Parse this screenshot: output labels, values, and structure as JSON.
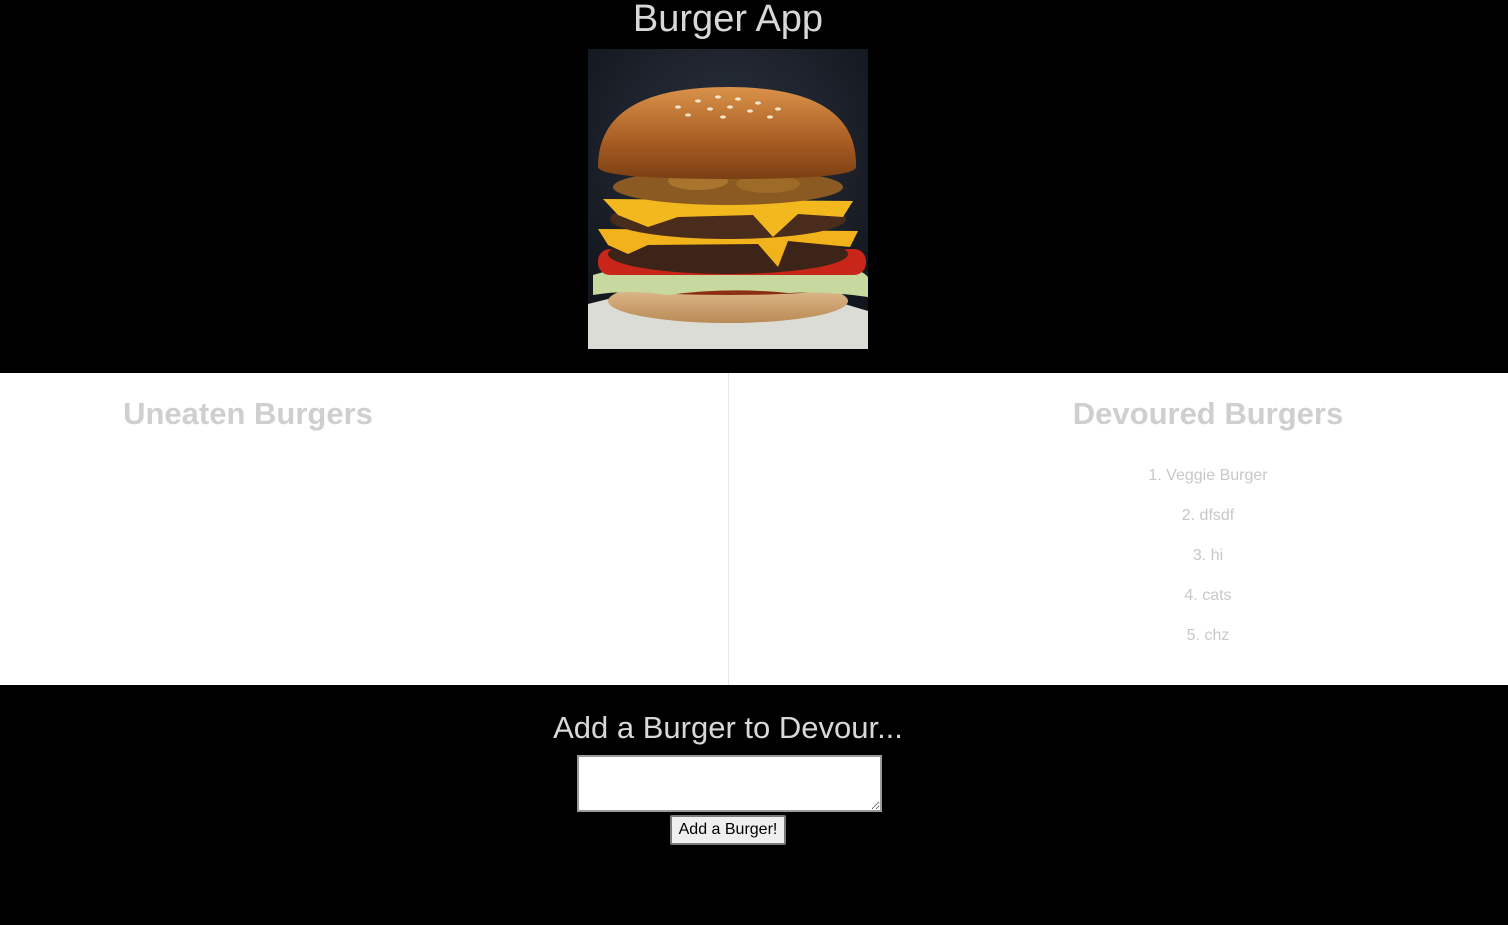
{
  "header": {
    "title": "Burger App"
  },
  "uneaten": {
    "title": "Uneaten Burgers",
    "items": []
  },
  "devoured": {
    "title": "Devoured Burgers",
    "items": [
      "1. Veggie Burger",
      "2. dfsdf",
      "3. hi",
      "4. cats",
      "5. chz"
    ]
  },
  "form": {
    "title": "Add a Burger to Devour...",
    "input_value": "",
    "submit_label": "Add a Burger!"
  },
  "colors": {
    "background": "#000000",
    "panel": "#ffffff",
    "heading_text": "#d8d8d8",
    "muted_text": "#c8c8c8"
  }
}
